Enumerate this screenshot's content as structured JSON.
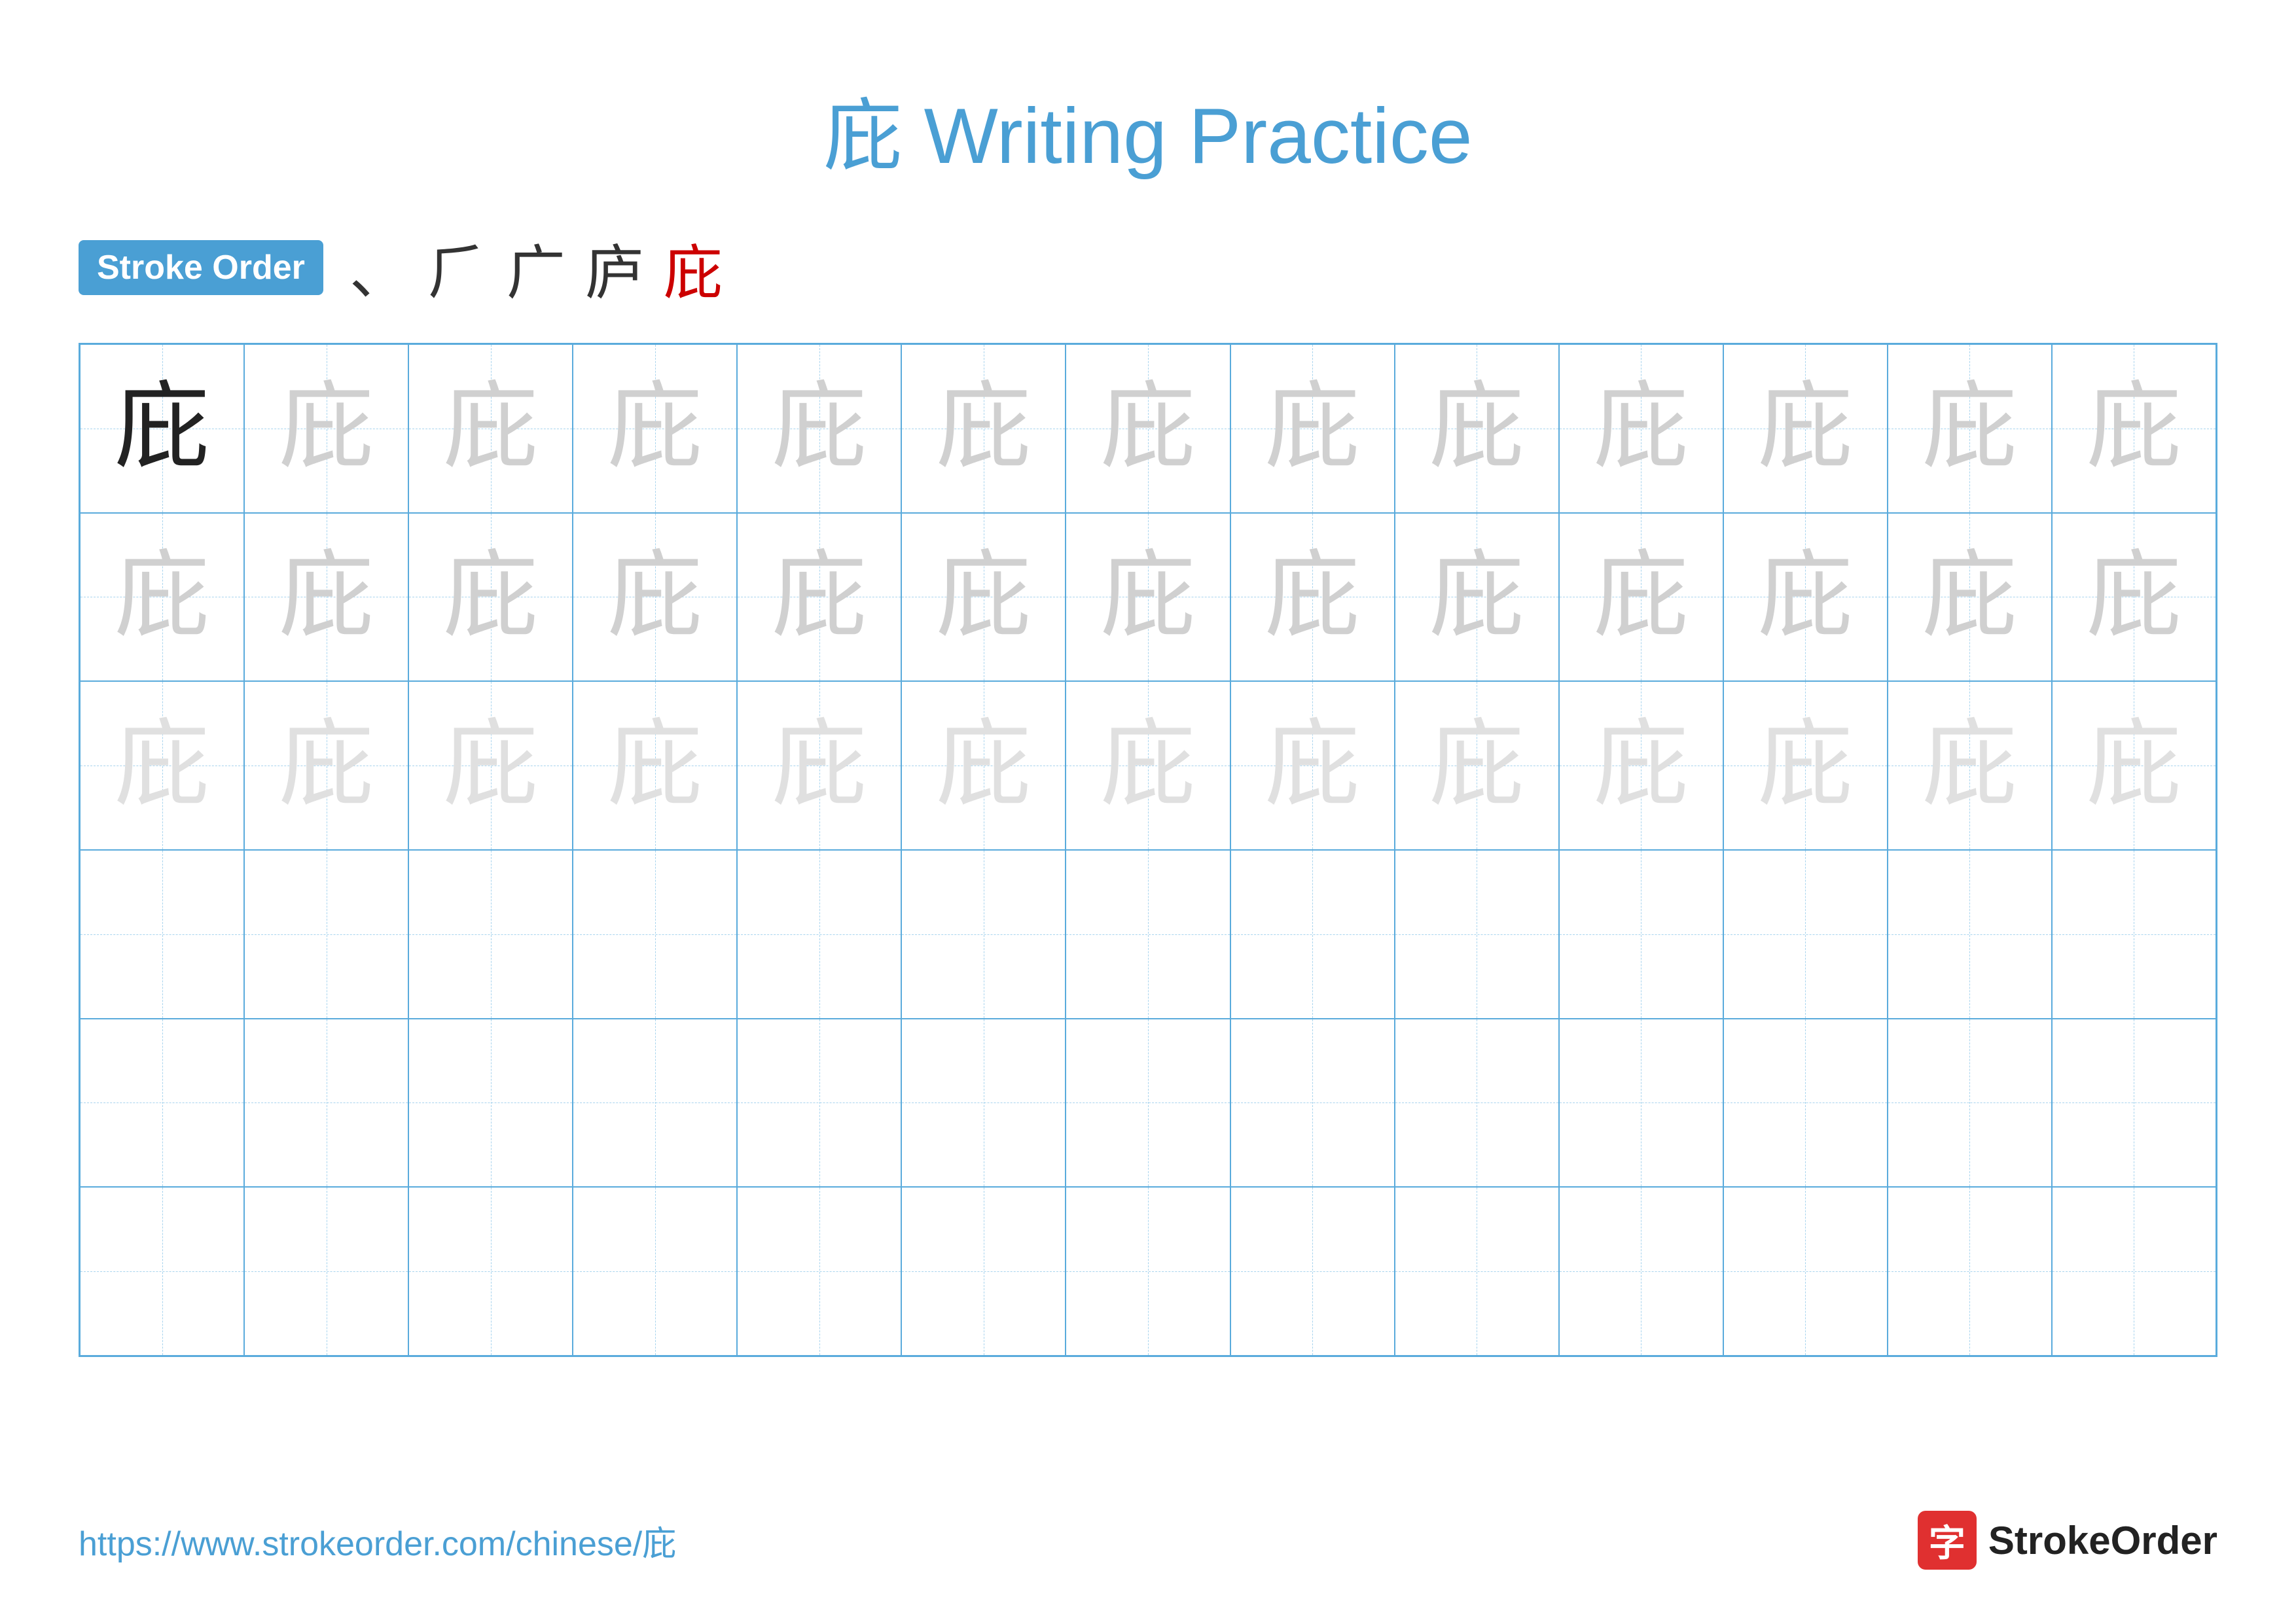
{
  "title": "庇 Writing Practice",
  "stroke_order_badge": "Stroke Order",
  "stroke_sequence": [
    "、",
    "⺁",
    "广",
    "庐",
    "庇"
  ],
  "character": "庇",
  "rows": [
    {
      "type": "dark_then_light",
      "dark_count": 1,
      "light_level": "light"
    },
    {
      "type": "all_light",
      "light_level": "light"
    },
    {
      "type": "all_lighter",
      "light_level": "lighter"
    },
    {
      "type": "empty"
    },
    {
      "type": "empty"
    },
    {
      "type": "empty"
    }
  ],
  "cols": 13,
  "footer": {
    "url": "https://www.strokeorder.com/chinese/庇",
    "logo_char": "字",
    "logo_text": "StrokeOrder"
  }
}
